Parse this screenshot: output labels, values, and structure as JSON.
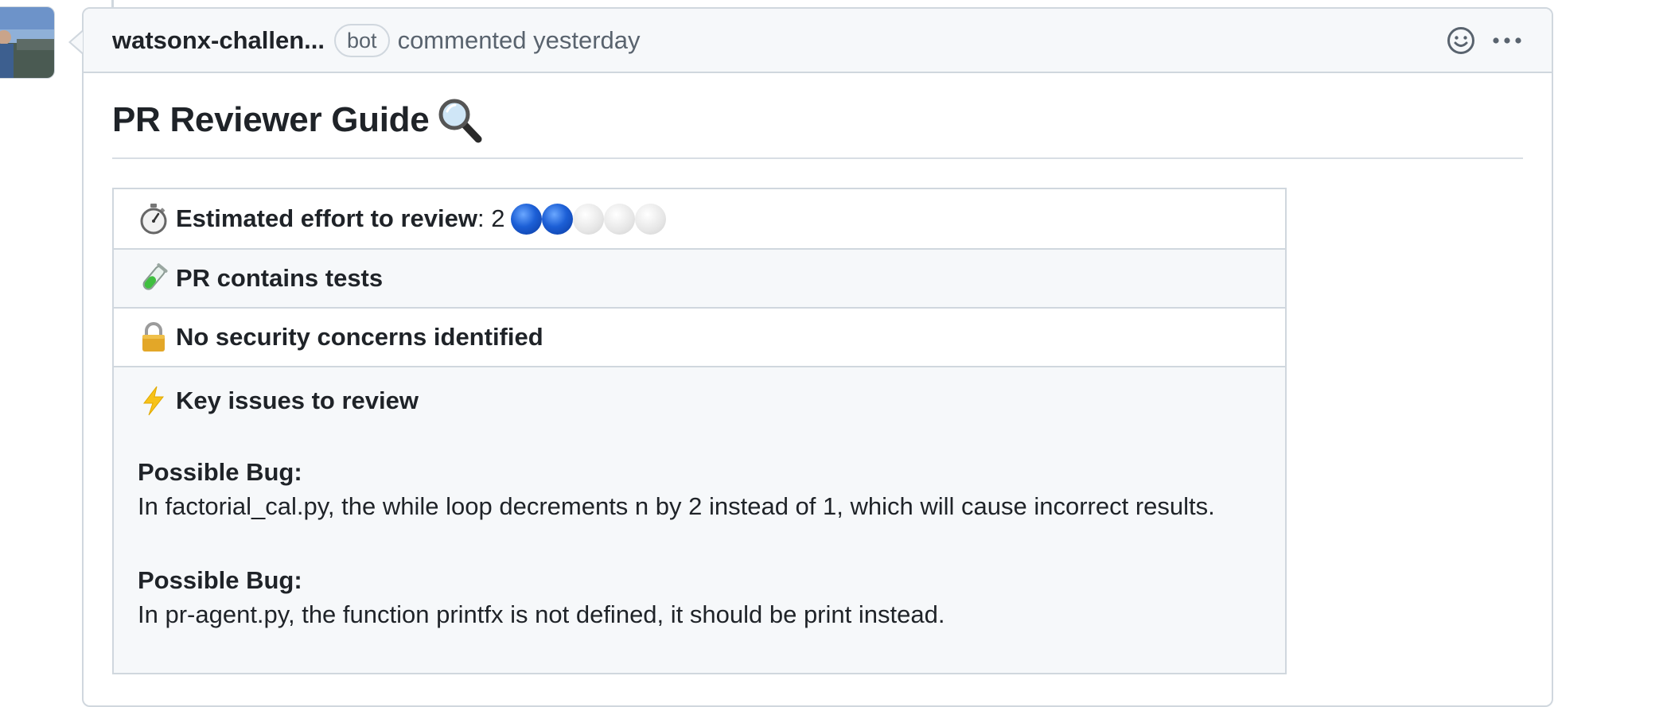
{
  "comment": {
    "author": "watsonx-challen...",
    "badge": "bot",
    "action": "commented yesterday"
  },
  "body": {
    "title": "PR Reviewer Guide",
    "effort": {
      "label": "Estimated effort to review",
      "suffix": ": 2",
      "score": 2,
      "max": 5
    },
    "tests_label": "PR contains tests",
    "security_label": "No security concerns identified",
    "issues_label": "Key issues to review",
    "issues": [
      {
        "title": "Possible Bug:",
        "text": "In factorial_cal.py, the while loop decrements n by 2 instead of 1, which will cause incorrect results."
      },
      {
        "title": "Possible Bug:",
        "text": "In pr-agent.py, the function printfx is not defined, it should be print instead."
      }
    ]
  },
  "colors": {
    "border": "#d0d7de",
    "header_bg": "#f6f8fa",
    "text": "#1f2328",
    "muted": "#59636e",
    "dot_filled": "#1c5fd6"
  },
  "icons": [
    "avatar",
    "smiley-icon",
    "kebab-icon",
    "magnifier-icon",
    "stopwatch-icon",
    "test-tube-icon",
    "lock-icon",
    "lightning-icon"
  ]
}
